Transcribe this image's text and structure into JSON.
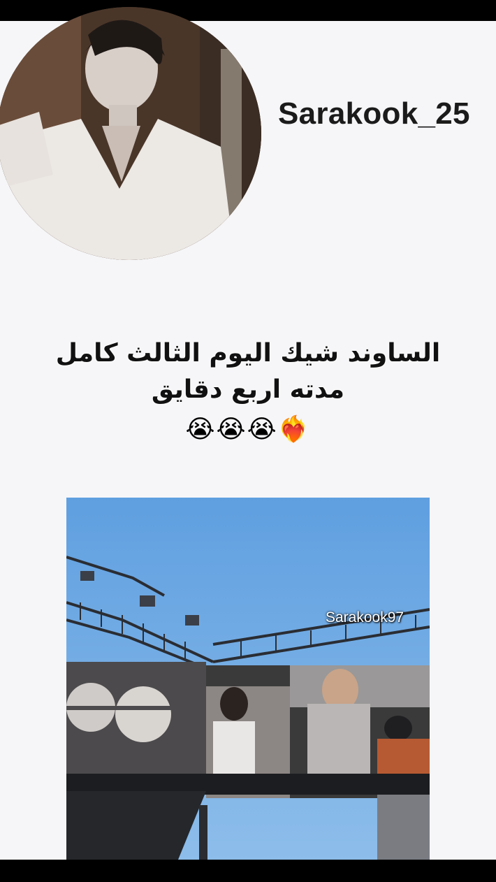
{
  "profile": {
    "username": "Sarakook_25",
    "avatar_icon": "profile-photo"
  },
  "post": {
    "caption_lines": [
      "الساوند شيك اليوم الثالث كامل",
      "مدته اربع دقايق"
    ],
    "emoji_line": "😭😭😭❤️‍🔥",
    "video_watermark": "Sarakook97"
  },
  "colors": {
    "background": "#f6f6f8",
    "sky": "#6fa8e0",
    "bars": "#000000"
  }
}
